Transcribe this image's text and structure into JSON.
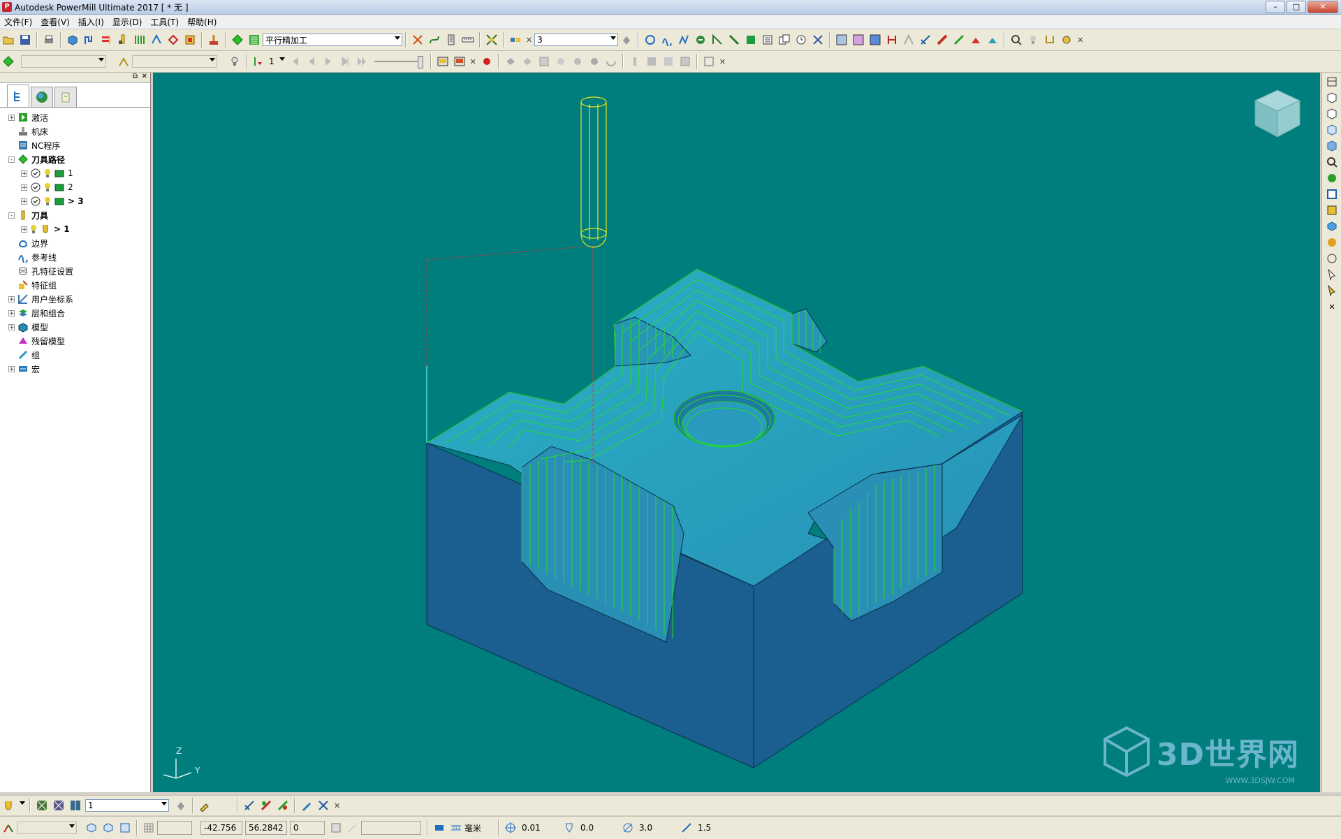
{
  "window": {
    "title": "Autodesk PowerMill Ultimate 2017    [ * 无 ]"
  },
  "menu": [
    "文件(F)",
    "查看(V)",
    "插入(I)",
    "显示(D)",
    "工具(T)",
    "帮助(H)"
  ],
  "toolbar1": {
    "strategy_combo": "平行精加工",
    "toolpath_combo": "3"
  },
  "toolbar2": {
    "tool_combo": "",
    "holder_combo": "",
    "step_value": "1"
  },
  "tree": [
    {
      "label": "激活",
      "icon": "activate-icon",
      "expand": "+",
      "level": 0,
      "bold": false
    },
    {
      "label": "机床",
      "icon": "machine-tool-icon",
      "expand": "",
      "level": 0,
      "bold": false
    },
    {
      "label": "NC程序",
      "icon": "nc-program-icon",
      "expand": "",
      "level": 0,
      "bold": false
    },
    {
      "label": "刀具路径",
      "icon": "toolpaths-icon",
      "expand": "-",
      "level": 0,
      "bold": true
    },
    {
      "label": "1",
      "icon": "toolpath-icon",
      "expand": "+",
      "level": 1,
      "bold": false
    },
    {
      "label": "2",
      "icon": "toolpath-icon",
      "expand": "+",
      "level": 1,
      "bold": false
    },
    {
      "label": "> 3",
      "icon": "toolpath-icon",
      "expand": "+",
      "level": 1,
      "bold": true
    },
    {
      "label": "刀具",
      "icon": "tools-icon",
      "expand": "-",
      "level": 0,
      "bold": true
    },
    {
      "label": "> 1",
      "icon": "tool-icon",
      "expand": "+",
      "level": 1,
      "bold": true
    },
    {
      "label": "边界",
      "icon": "boundary-icon",
      "expand": "",
      "level": 0,
      "bold": false
    },
    {
      "label": "参考线",
      "icon": "pattern-icon",
      "expand": "",
      "level": 0,
      "bold": false
    },
    {
      "label": "孔特征设置",
      "icon": "hole-feature-icon",
      "expand": "",
      "level": 0,
      "bold": false
    },
    {
      "label": "特征组",
      "icon": "feature-group-icon",
      "expand": "",
      "level": 0,
      "bold": false
    },
    {
      "label": "用户坐标系",
      "icon": "workplane-icon",
      "expand": "+",
      "level": 0,
      "bold": false
    },
    {
      "label": "层和组合",
      "icon": "levels-icon",
      "expand": "+",
      "level": 0,
      "bold": false
    },
    {
      "label": "模型",
      "icon": "model-icon",
      "expand": "+",
      "level": 0,
      "bold": false
    },
    {
      "label": "残留模型",
      "icon": "stock-model-icon",
      "expand": "",
      "level": 0,
      "bold": false
    },
    {
      "label": "组",
      "icon": "group-icon",
      "expand": "",
      "level": 0,
      "bold": false
    },
    {
      "label": "宏",
      "icon": "macro-icon",
      "expand": "+",
      "level": 0,
      "bold": false
    }
  ],
  "axes": {
    "z": "Z",
    "y": "Y"
  },
  "bottom_toolbar": {
    "feature_combo": "1"
  },
  "status": {
    "x": "-42.756",
    "y": "56.2842",
    "z": "0",
    "units": "毫米",
    "tolerance": "0.01",
    "thickness": "0.0",
    "diameter": "3.0",
    "stepover": "1.5"
  },
  "watermark": {
    "text": "3D世界网",
    "sub": "WWW.3DSJW.COM"
  },
  "colors": {
    "viewport": "#007d7d",
    "model_side": "#1a5f8f",
    "model_top": "#2aa6b8",
    "toolpath": "#22e51a",
    "tool": "#e4e41e"
  }
}
